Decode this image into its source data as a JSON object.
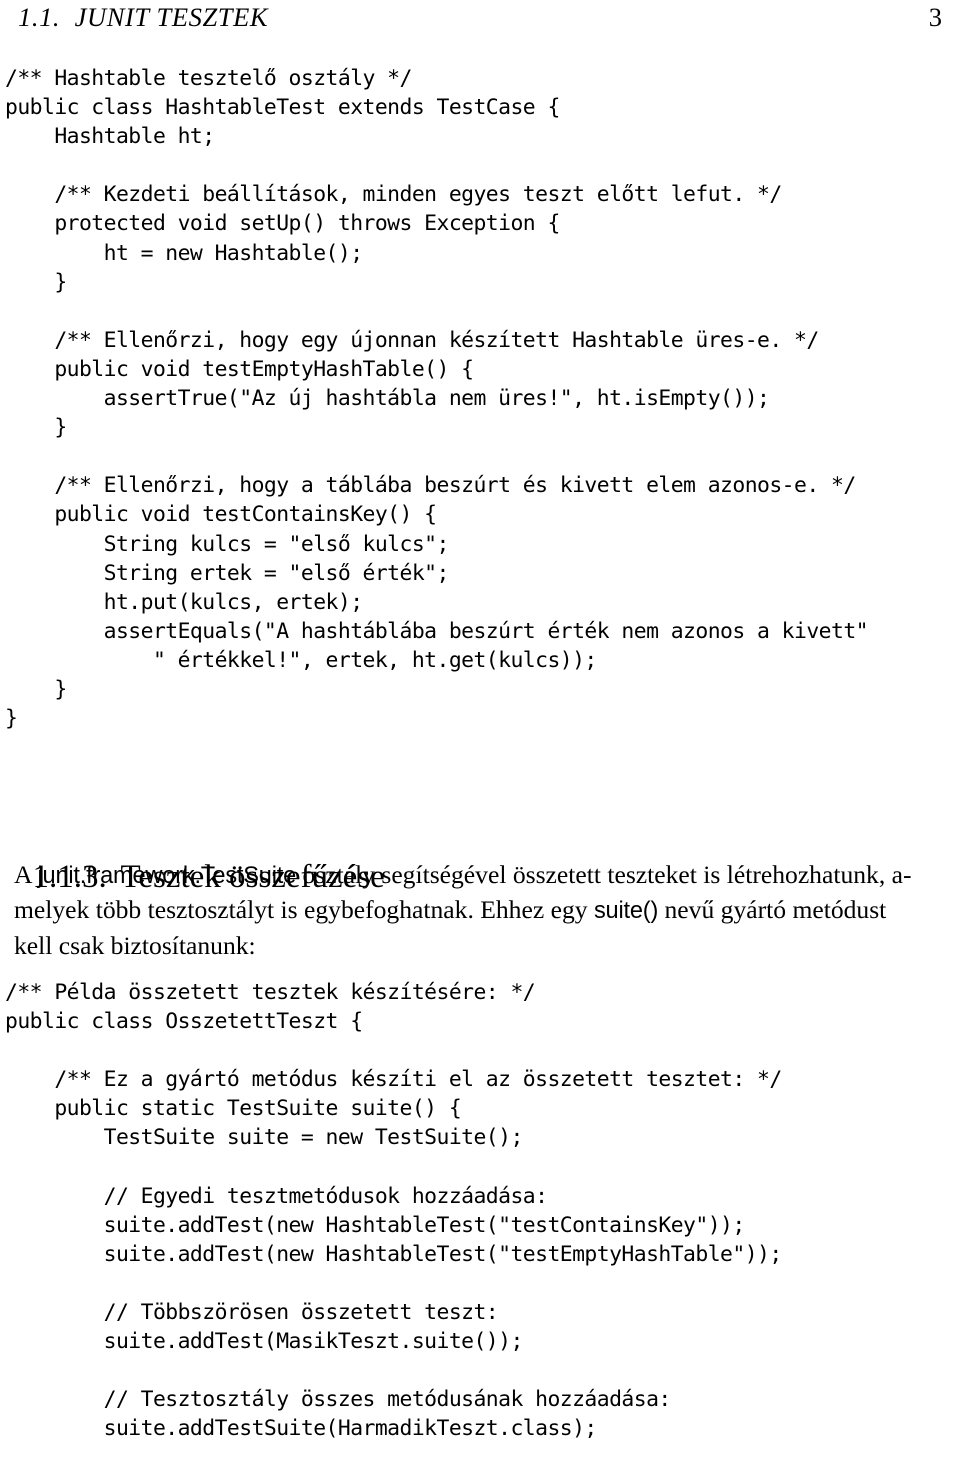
{
  "header": {
    "title": "1.1.  JUNIT TESZTEK",
    "page_number": "3"
  },
  "code_block_1": {
    "lines": [
      "/** Hashtable tesztelő osztály */",
      "public class HashtableTest extends TestCase {",
      "    Hashtable ht;",
      "",
      "    /** Kezdeti beállítások, minden egyes teszt előtt lefut. */",
      "    protected void setUp() throws Exception {",
      "        ht = new Hashtable();",
      "    }",
      "",
      "    /** Ellenőrzi, hogy egy újonnan készített Hashtable üres-e. */",
      "    public void testEmptyHashTable() {",
      "        assertTrue(\"Az új hashtábla nem üres!\", ht.isEmpty());",
      "    }",
      "",
      "    /** Ellenőrzi, hogy a táblába beszúrt és kivett elem azonos-e. */",
      "    public void testContainsKey() {",
      "        String kulcs = \"első kulcs\";",
      "        String ertek = \"első érték\";",
      "        ht.put(kulcs, ertek);",
      "        assertEquals(\"A hashtáblába beszúrt érték nem azonos a kivett\"",
      "            \" értékkel!\", ertek, ht.get(kulcs));",
      "    }",
      "}"
    ]
  },
  "section": {
    "number": "1.1.3.",
    "title": "Tesztek összefűzése"
  },
  "paragraph": {
    "line1_pre": "A ",
    "line1_code": "junit.framework.TestSuite",
    "line1_post": " osztály segítségével összetett teszteket is létrehozhatunk, a-",
    "line2_pre": "melyek több tesztosztályt is egybefoghatnak. Ehhez egy ",
    "line2_code": "suite()",
    "line2_post": " nevű gyártó metódust",
    "line3": "kell csak biztosítanunk:"
  },
  "code_block_2": {
    "lines": [
      "/** Példa összetett tesztek készítésére: */",
      "public class OsszetettTeszt {",
      "",
      "    /** Ez a gyártó metódus készíti el az összetett tesztet: */",
      "    public static TestSuite suite() {",
      "        TestSuite suite = new TestSuite();",
      "",
      "        // Egyedi tesztmetódusok hozzáadása:",
      "        suite.addTest(new HashtableTest(\"testContainsKey\"));",
      "        suite.addTest(new HashtableTest(\"testEmptyHashTable\"));",
      "",
      "        // Többszörösen összetett teszt:",
      "        suite.addTest(MasikTeszt.suite());",
      "",
      "        // Tesztosztály összes metódusának hozzáadása:",
      "        suite.addTestSuite(HarmadikTeszt.class);"
    ]
  }
}
